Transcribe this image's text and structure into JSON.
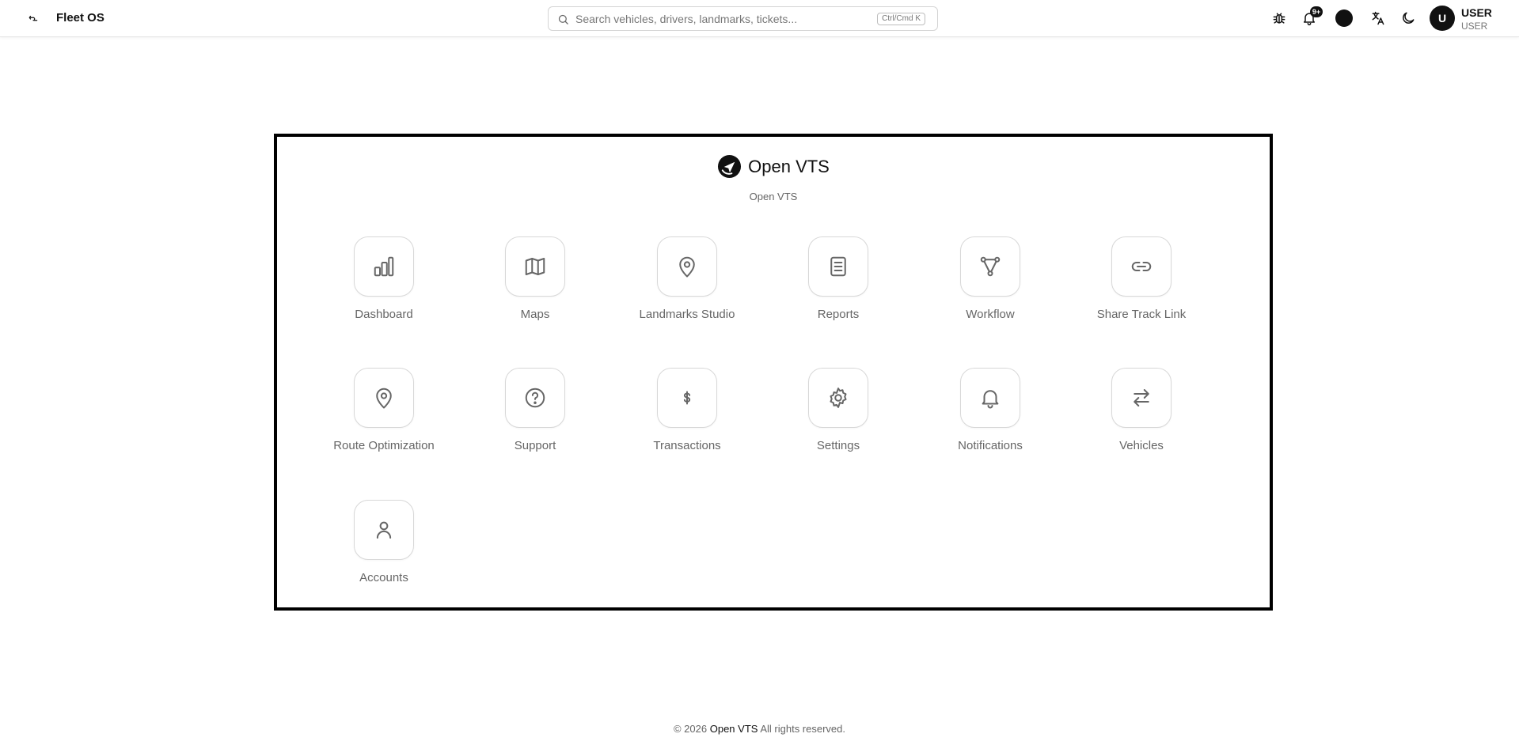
{
  "app": {
    "title": "Fleet OS"
  },
  "search": {
    "placeholder": "Search vehicles, drivers, landmarks, tickets...",
    "shortcut": "Ctrl/Cmd K"
  },
  "notifications": {
    "badge": "9+"
  },
  "user": {
    "initial": "U",
    "name": "USER",
    "role": "USER"
  },
  "brand": {
    "name": "Open VTS",
    "subtitle": "Open VTS"
  },
  "apps": [
    {
      "label": "Dashboard",
      "icon": "bar-chart-icon"
    },
    {
      "label": "Maps",
      "icon": "map-icon"
    },
    {
      "label": "Landmarks Studio",
      "icon": "map-pin-icon"
    },
    {
      "label": "Reports",
      "icon": "document-icon"
    },
    {
      "label": "Workflow",
      "icon": "workflow-icon"
    },
    {
      "label": "Share Track Link",
      "icon": "link-icon"
    },
    {
      "label": "Route Optimization",
      "icon": "map-pin-icon"
    },
    {
      "label": "Support",
      "icon": "help-circle-icon"
    },
    {
      "label": "Transactions",
      "icon": "dollar-icon"
    },
    {
      "label": "Settings",
      "icon": "gear-icon"
    },
    {
      "label": "Notifications",
      "icon": "bell-icon"
    },
    {
      "label": "Vehicles",
      "icon": "arrows-swap-icon"
    },
    {
      "label": "Accounts",
      "icon": "user-icon"
    }
  ],
  "footer": {
    "copyright": "© 2026",
    "brand": "Open VTS",
    "rights": "All rights reserved."
  }
}
